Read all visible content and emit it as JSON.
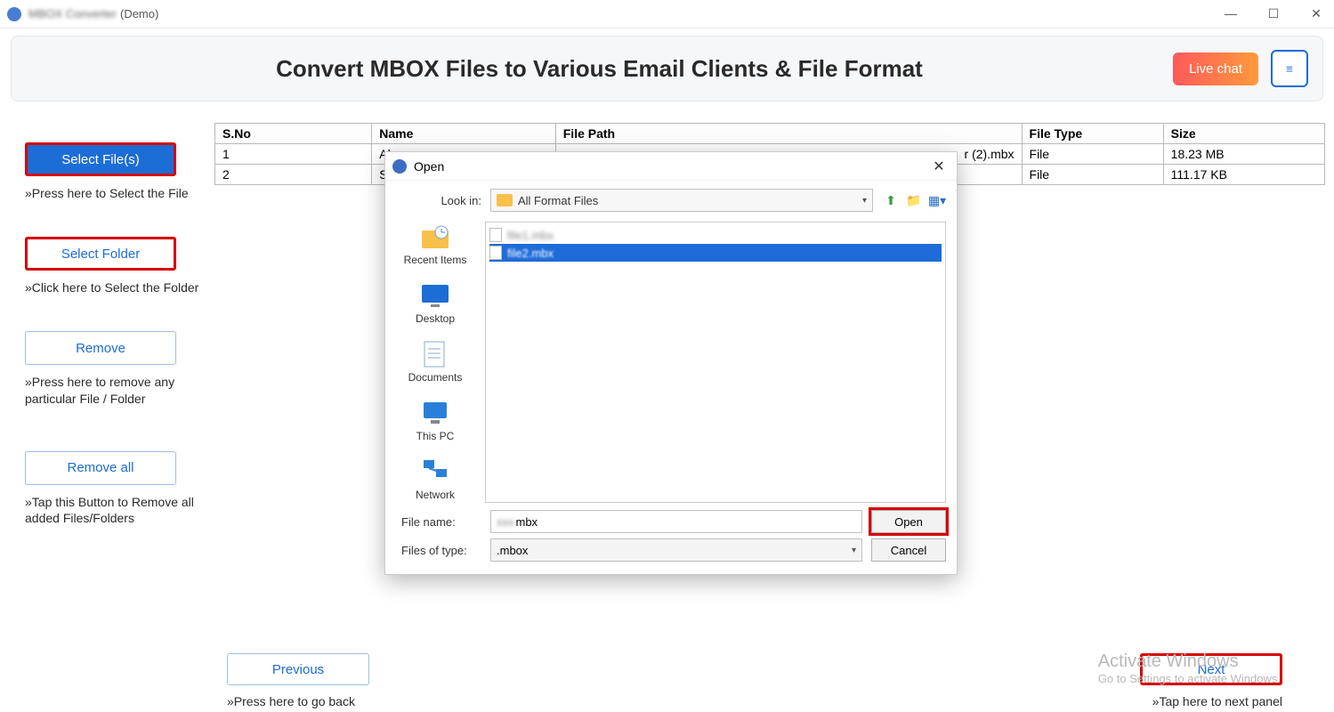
{
  "window": {
    "title_blurred": "MBOX Converter",
    "suffix": "(Demo)",
    "controls": {
      "min": "—",
      "max": "☐",
      "close": "✕"
    }
  },
  "header": {
    "title": "Convert MBOX Files to Various Email Clients & File Format",
    "live_chat": "Live chat",
    "menu_icon": "≡"
  },
  "sidebar": {
    "select_files": "Select File(s)",
    "select_files_hint": "»Press here to Select the File",
    "select_folder": "Select Folder",
    "select_folder_hint": "»Click here to Select the Folder",
    "remove": "Remove",
    "remove_hint": "»Press here to remove any particular File / Folder",
    "remove_all": "Remove all",
    "remove_all_hint": "»Tap this Button to Remove all added Files/Folders"
  },
  "table": {
    "headers": {
      "sno": "S.No",
      "name": "Name",
      "path": "File Path",
      "type": "File Type",
      "size": "Size"
    },
    "rows": [
      {
        "sno": "1",
        "name": "Al",
        "path": "r (2).mbx",
        "type": "File",
        "size": "18.23 MB"
      },
      {
        "sno": "2",
        "name": "Se",
        "path": "",
        "type": "File",
        "size": "111.17 KB"
      }
    ]
  },
  "bottom_nav": {
    "previous": "Previous",
    "previous_hint": "»Press here to go back",
    "next": "Next",
    "next_hint": "»Tap here to next panel"
  },
  "watermark": {
    "line1": "Activate Windows",
    "line2": "Go to Settings to activate Windows."
  },
  "dialog": {
    "title": "Open",
    "look_in_label": "Look in:",
    "look_in_value": "All Format Files",
    "toolbar_icons": {
      "up": "folder-up-icon",
      "new": "new-folder-icon",
      "view": "view-menu-icon"
    },
    "places": [
      {
        "id": "recent",
        "label": "Recent Items"
      },
      {
        "id": "desktop",
        "label": "Desktop"
      },
      {
        "id": "documents",
        "label": "Documents"
      },
      {
        "id": "thispc",
        "label": "This PC"
      },
      {
        "id": "network",
        "label": "Network"
      }
    ],
    "file_items": [
      {
        "name": "file1.mbx",
        "selected": false,
        "blurred": true
      },
      {
        "name": "file2.mbx",
        "selected": true,
        "blurred": true
      }
    ],
    "file_name_label": "File name:",
    "file_name_value_suffix": "mbx",
    "file_type_label": "Files of type:",
    "file_type_value": ".mbox",
    "open_btn": "Open",
    "cancel_btn": "Cancel"
  }
}
